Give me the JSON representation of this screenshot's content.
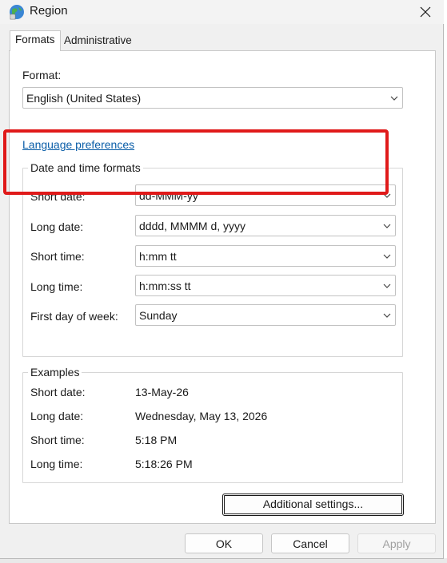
{
  "window": {
    "title": "Region"
  },
  "tabs": [
    {
      "label": "Formats",
      "active": true
    },
    {
      "label": "Administrative",
      "active": false
    }
  ],
  "format": {
    "label": "Format:",
    "value": "English (United States)"
  },
  "language_link": "Language preferences",
  "date_time_formats": {
    "title": "Date and time formats",
    "fields": [
      {
        "label": "Short date:",
        "value": "dd-MMM-yy"
      },
      {
        "label": "Long date:",
        "value": "dddd, MMMM d, yyyy"
      },
      {
        "label": "Short time:",
        "value": "h:mm tt"
      },
      {
        "label": "Long time:",
        "value": "h:mm:ss tt"
      },
      {
        "label": "First day of week:",
        "value": "Sunday"
      }
    ]
  },
  "examples": {
    "title": "Examples",
    "rows": [
      {
        "label": "Short date:",
        "value": "13-May-26"
      },
      {
        "label": "Long date:",
        "value": "Wednesday, May 13, 2026"
      },
      {
        "label": "Short time:",
        "value": "5:18 PM"
      },
      {
        "label": "Long time:",
        "value": "5:18:26 PM"
      }
    ]
  },
  "buttons": {
    "additional_settings": "Additional settings...",
    "ok": "OK",
    "cancel": "Cancel",
    "apply": "Apply"
  },
  "colors": {
    "highlight": "#e01a1a",
    "link": "#0b5ea8"
  },
  "icons": {
    "app": "globe-region-icon",
    "close": "close-icon",
    "dropdown": "chevron-down-icon"
  }
}
